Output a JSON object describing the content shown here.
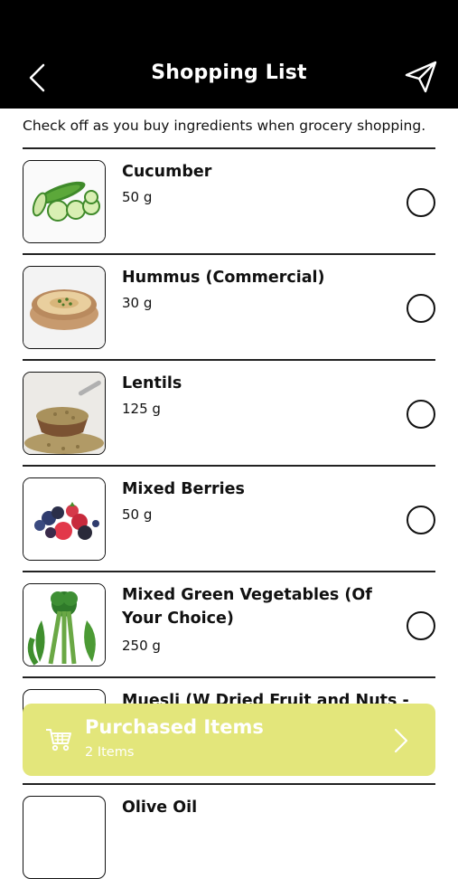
{
  "header": {
    "title": "Shopping List",
    "back_icon": "chevron-left-icon",
    "share_icon": "send-icon"
  },
  "subtitle": "Check off as you buy ingredients when grocery shopping.",
  "items": [
    {
      "name": "Cucumber",
      "qty": "50 g",
      "checked": false
    },
    {
      "name": "Hummus (Commercial)",
      "qty": "30 g",
      "checked": false
    },
    {
      "name": "Lentils",
      "qty": "125 g",
      "checked": false
    },
    {
      "name": "Mixed Berries",
      "qty": "50 g",
      "checked": false
    },
    {
      "name": "Mixed Green Vegetables (Of Your Choice)",
      "qty": "250 g",
      "checked": false
    },
    {
      "name": "Muesli (W Dried Fruit and Nuts -",
      "qty": "",
      "checked": false
    },
    {
      "name": "Olive Oil",
      "qty": "",
      "checked": false
    }
  ],
  "purchased": {
    "title": "Purchased Items",
    "count": "2 Items",
    "color": "#e3e67b"
  },
  "colors": {
    "header_bg": "#000000",
    "text": "#111111"
  }
}
